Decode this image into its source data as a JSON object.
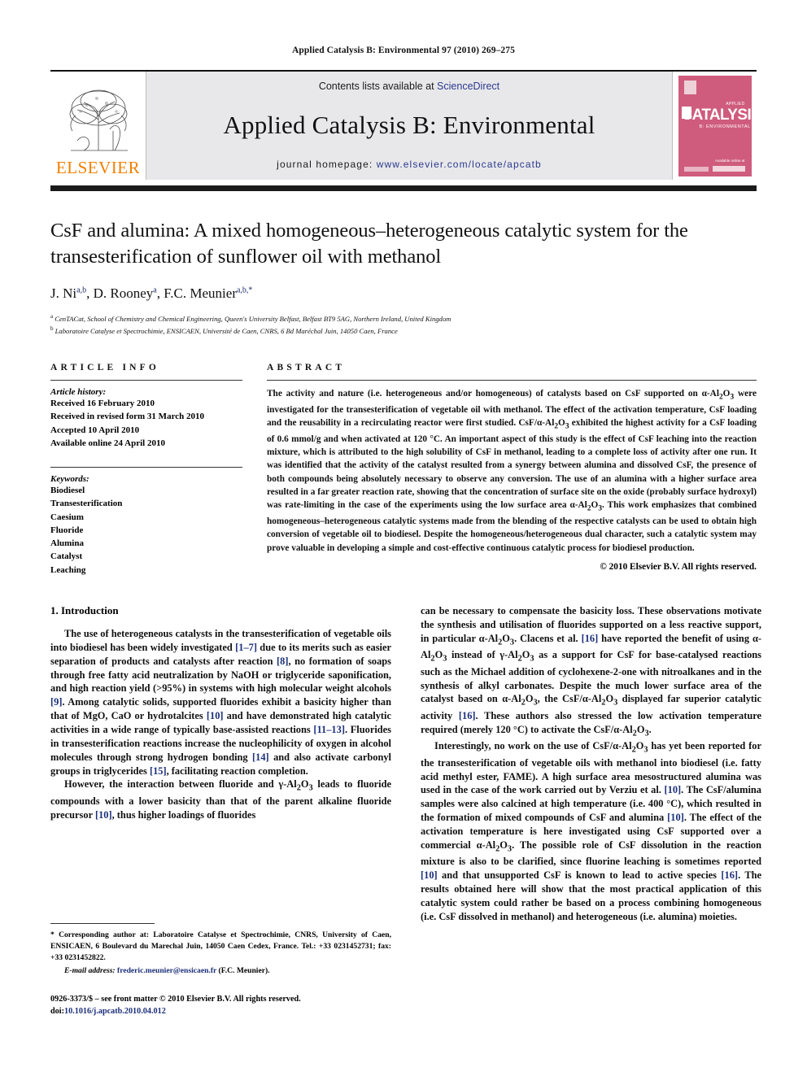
{
  "running_head": "Applied Catalysis B: Environmental 97 (2010) 269–275",
  "masthead": {
    "contents_prefix": "Contents lists available at ",
    "sciencedirect": "ScienceDirect",
    "journal_title": "Applied Catalysis B: Environmental",
    "homepage_prefix": "journal homepage: ",
    "homepage_url": "www.elsevier.com/locate/apcatb",
    "publisher": "ELSEVIER",
    "cover": {
      "applied": "APPLIED",
      "title": "CATALYSIS",
      "subtitle": "B: ENVIRONMENTAL",
      "footer": "Available online at"
    },
    "accent_orange": "#F08000",
    "link_blue": "#2b3a8f",
    "cover_pink": "#cf5c7d",
    "band_grey": "#e8e8ea"
  },
  "article": {
    "title": "CsF and alumina: A mixed homogeneous–heterogeneous catalytic system for the transesterification of sunflower oil with methanol",
    "authors_html": "J. Ni<sup>a,b</sup>, D. Rooney<sup>a</sup>, F.C. Meunier<sup>a,b,*</sup>",
    "affiliation_a": "CenTACat, School of Chemistry and Chemical Engineering, Queen's University Belfast, Belfast BT9 5AG, Northern Ireland, United Kingdom",
    "affiliation_b": "Laboratoire Catalyse et Spectrochimie, ENSICAEN, Université de Caen, CNRS, 6 Bd Maréchal Juin, 14050 Caen, France"
  },
  "article_info": {
    "heading": "ARTICLE INFO",
    "history_label": "Article history:",
    "history": [
      "Received 16 February 2010",
      "Received in revised form 31 March 2010",
      "Accepted 10 April 2010",
      "Available online 24 April 2010"
    ],
    "keywords_label": "Keywords:",
    "keywords": [
      "Biodiesel",
      "Transesterification",
      "Caesium",
      "Fluoride",
      "Alumina",
      "Catalyst",
      "Leaching"
    ]
  },
  "abstract": {
    "heading": "ABSTRACT",
    "text": "The activity and nature (i.e. heterogeneous and/or homogeneous) of catalysts based on CsF supported on α-Al2O3 were investigated for the transesterification of vegetable oil with methanol. The effect of the activation temperature, CsF loading and the reusability in a recirculating reactor were first studied. CsF/α-Al2O3 exhibited the highest activity for a CsF loading of 0.6 mmol/g and when activated at 120 °C. An important aspect of this study is the effect of CsF leaching into the reaction mixture, which is attributed to the high solubility of CsF in methanol, leading to a complete loss of activity after one run. It was identified that the activity of the catalyst resulted from a synergy between alumina and dissolved CsF, the presence of both compounds being absolutely necessary to observe any conversion. The use of an alumina with a higher surface area resulted in a far greater reaction rate, showing that the concentration of surface site on the oxide (probably surface hydroxyl) was rate-limiting in the case of the experiments using the low surface area α-Al2O3. This work emphasizes that combined homogeneous–heterogeneous catalytic systems made from the blending of the respective catalysts can be used to obtain high conversion of vegetable oil to biodiesel. Despite the homogeneous/heterogeneous dual character, such a catalytic system may prove valuable in developing a simple and cost-effective continuous catalytic process for biodiesel production.",
    "copyright": "© 2010 Elsevier B.V. All rights reserved."
  },
  "introduction": {
    "heading": "1. Introduction",
    "left_paragraphs": [
      "The use of heterogeneous catalysts in the transesterification of vegetable oils into biodiesel has been widely investigated [1–7] due to its merits such as easier separation of products and catalysts after reaction [8], no formation of soaps through free fatty acid neutralization by NaOH or triglyceride saponification, and high reaction yield (>95%) in systems with high molecular weight alcohols [9]. Among catalytic solids, supported fluorides exhibit a basicity higher than that of MgO, CaO or hydrotalcites [10] and have demonstrated high catalytic activities in a wide range of typically base-assisted reactions [11–13]. Fluorides in transesterification reactions increase the nucleophilicity of oxygen in alcohol molecules through strong hydrogen bonding [14] and also activate carbonyl groups in triglycerides [15], facilitating reaction completion.",
      "However, the interaction between fluoride and γ-Al2O3 leads to fluoride compounds with a lower basicity than that of the parent alkaline fluoride precursor [10], thus higher loadings of fluorides"
    ],
    "right_paragraphs": [
      "can be necessary to compensate the basicity loss. These observations motivate the synthesis and utilisation of fluorides supported on a less reactive support, in particular α-Al2O3. Clacens et al. [16] have reported the benefit of using α-Al2O3 instead of γ-Al2O3 as a support for CsF for base-catalysed reactions such as the Michael addition of cyclohexene-2-one with nitroalkanes and in the synthesis of alkyl carbonates. Despite the much lower surface area of the catalyst based on α-Al2O3, the CsF/α-Al2O3 displayed far superior catalytic activity [16]. These authors also stressed the low activation temperature required (merely 120 °C) to activate the CsF/α-Al2O3.",
      "Interestingly, no work on the use of CsF/α-Al2O3 has yet been reported for the transesterification of vegetable oils with methanol into biodiesel (i.e. fatty acid methyl ester, FAME). A high surface area mesostructured alumina was used in the case of the work carried out by Verziu et al. [10]. The CsF/alumina samples were also calcined at high temperature (i.e. 400 °C), which resulted in the formation of mixed compounds of CsF and alumina [10]. The effect of the activation temperature is here investigated using CsF supported over a commercial α-Al2O3. The possible role of CsF dissolution in the reaction mixture is also to be clarified, since fluorine leaching is sometimes reported [10] and that unsupported CsF is known to lead to active species [16]. The results obtained here will show that the most practical application of this catalytic system could rather be based on a process combining homogeneous (i.e. CsF dissolved in methanol) and heterogeneous (i.e. alumina) moieties."
    ]
  },
  "footnotes": {
    "corresponding": "* Corresponding author at: Laboratoire Catalyse et Spectrochimie, CNRS, University of Caen, ENSICAEN, 6 Boulevard du Marechal Juin, 14050 Caen Cedex, France. Tel.: +33 0231452731; fax: +33 0231452822.",
    "email_label": "E-mail address:",
    "email": "frederic.meunier@ensicaen.fr",
    "email_suffix": "(F.C. Meunier).",
    "issn_line": "0926-3373/$ – see front matter © 2010 Elsevier B.V. All rights reserved.",
    "doi_prefix": "doi:",
    "doi": "10.1016/j.apcatb.2010.04.012"
  }
}
